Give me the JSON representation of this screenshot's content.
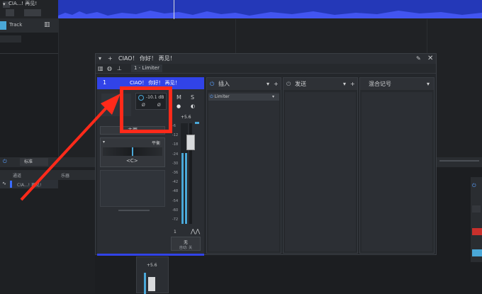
{
  "track": {
    "name_top": "CIA...! 再见!",
    "type_label": "Track",
    "channel_list_label": "CIA...! 再见!"
  },
  "bottom_bar": {
    "mode": "标准",
    "col_channel": "通道",
    "col_instrument": "乐器"
  },
  "modal": {
    "title": "CIAO！ 你好！ 再见！",
    "preset": "1 - Limiter",
    "channel_number": "1",
    "channel_name": "CIAO！ 你好！ 再见！",
    "gain_value": "-10.1 dB",
    "phase_left": "Ø",
    "phase_right": "Ø",
    "m_label": "M",
    "s_label": "S",
    "fader_value": "+5.6",
    "main_output": "主要",
    "pan_label": "平衡",
    "pan_value": "<C>",
    "meter_ticks": [
      "-6",
      "-12",
      "-18",
      "-24",
      "-30",
      "-36",
      "-42",
      "-48",
      "-54",
      "-60",
      "-72"
    ],
    "automation_number": "1",
    "automation_value": "无",
    "automation_mode": "自动: 关",
    "inserts_label": "插入",
    "insert_item": "Limiter",
    "sends_label": "发送",
    "notes_label": "混合记号"
  },
  "mini_fader_value": "+5.6",
  "colors": {
    "accent_blue": "#3143e8",
    "annotation_red": "#ff2a1a"
  }
}
